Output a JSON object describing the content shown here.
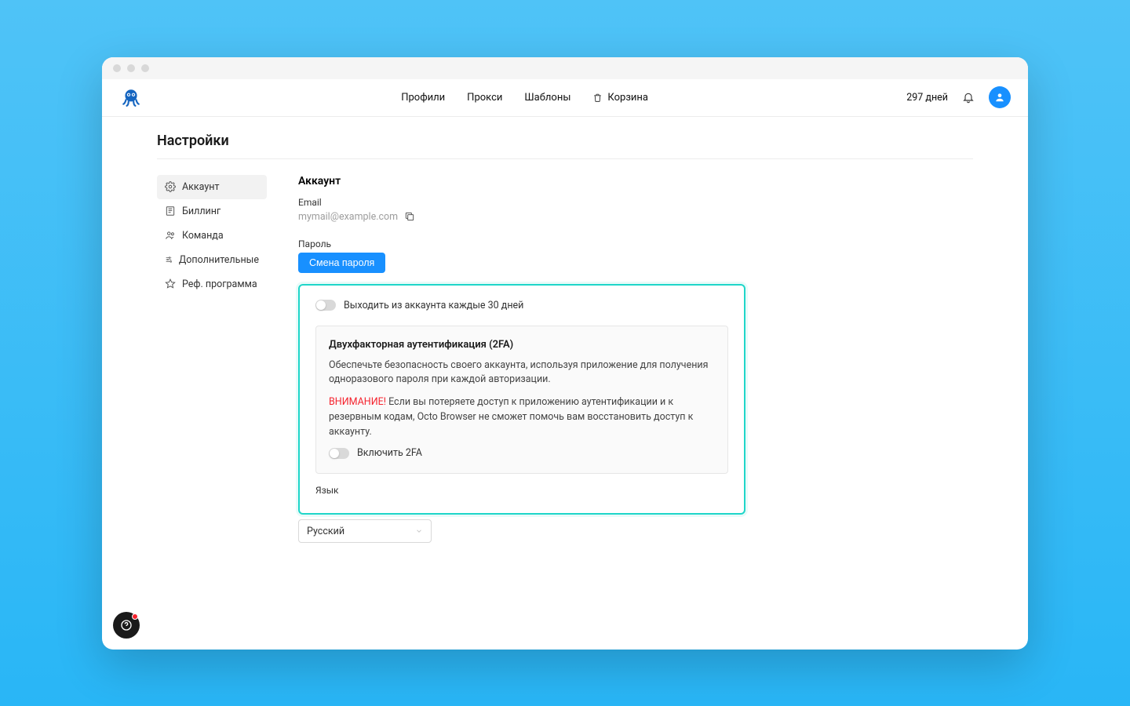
{
  "topbar": {
    "nav": {
      "profiles": "Профили",
      "proxy": "Прокси",
      "templates": "Шаблоны",
      "trash": "Корзина"
    },
    "days_left": "297 дней"
  },
  "page": {
    "title": "Настройки"
  },
  "sidebar": {
    "account": "Аккаунт",
    "billing": "Биллинг",
    "team": "Команда",
    "advanced": "Дополнительные",
    "referral": "Реф. программа"
  },
  "main": {
    "section_title": "Аккаунт",
    "email_label": "Email",
    "email_value": "mymail@example.com",
    "password_label": "Пароль",
    "change_password_btn": "Смена пароля",
    "logout_toggle_label": "Выходить из аккаунта каждые 30 дней",
    "twofa": {
      "title": "Двухфакторная аутентификация (2FA)",
      "desc": "Обеспечьте безопасность своего аккаунта, используя приложение для получения одноразового пароля при каждой авторизации.",
      "warning_label": "ВНИМАНИЕ!",
      "warning_text": " Если вы потеряете доступ к приложению аутентификации и к резервным кодам, Octo Browser не сможет помочь вам восстановить доступ к аккаунту.",
      "enable_label": "Включить 2FA"
    },
    "language_label": "Язык",
    "language_value": "Русский"
  }
}
